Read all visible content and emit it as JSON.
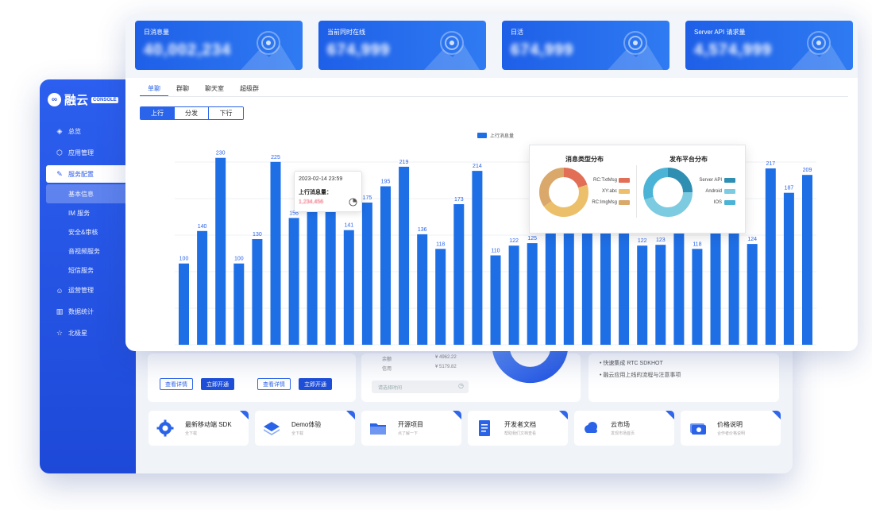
{
  "sidebar": {
    "brand": "融云",
    "brand_badge": "CONSOLE",
    "items": [
      {
        "label": "总览",
        "icon": "dashboard-icon"
      },
      {
        "label": "应用管理",
        "icon": "cube-icon"
      },
      {
        "label": "服务配置",
        "icon": "wrench-icon"
      },
      {
        "label": "基本信息"
      },
      {
        "label": "IM 服务"
      },
      {
        "label": "安全&审核"
      },
      {
        "label": "音视频服务"
      },
      {
        "label": "短信服务"
      },
      {
        "label": "运营管理",
        "icon": "user-group-icon"
      },
      {
        "label": "数据统计",
        "icon": "bar-chart-icon"
      },
      {
        "label": "北极星",
        "icon": "star-icon"
      }
    ]
  },
  "back": {
    "detail_label": "查看详情",
    "open_label": "立即开通",
    "money_1_label": "余额",
    "money_1": "¥ 4962.22",
    "money_2_label": "信用",
    "money_2": "¥ 5179.82",
    "search_placeholder": "请选择时间",
    "notices": [
      "快速集成 RTC SDKHOT",
      "融云应用上线的流程与注意事项"
    ],
    "tiles": [
      {
        "title": "最新移动端 SDK",
        "sub": "全下载",
        "icon": "gear-icon"
      },
      {
        "title": "Demo体验",
        "sub": "全下载",
        "icon": "layers-icon"
      },
      {
        "title": "开源项目",
        "sub": "点了解一下",
        "icon": "folder-icon"
      },
      {
        "title": "开发者文档",
        "sub": "帮助我们文档查看",
        "icon": "document-icon"
      },
      {
        "title": "云市场",
        "sub": "发现市场首页",
        "icon": "cloud-icon"
      },
      {
        "title": "价格说明",
        "sub": "合作者价格说明",
        "icon": "price-icon"
      }
    ]
  },
  "stats": [
    {
      "label": "日消息量",
      "value": "40,002,234"
    },
    {
      "label": "当前同时在线",
      "value": "674,999"
    },
    {
      "label": "日活",
      "value": "674,999"
    },
    {
      "label": "Server API 请求量",
      "value": "4,574,999"
    }
  ],
  "tabs": [
    "单聊",
    "群聊",
    "聊天室",
    "超级群"
  ],
  "segments": [
    "上行",
    "分发",
    "下行"
  ],
  "tooltip": {
    "date": "2023-02-14 23:59",
    "label": "上行消息量：",
    "value": "1,234,456"
  },
  "colors": {
    "primary": "#1e6fe6",
    "sidebar": "#2a5bea",
    "tooltip_value": "#e9435a"
  },
  "chart_data": {
    "type": "bar",
    "legend": "上行消息量",
    "legend_position": "top",
    "values": [
      100,
      140,
      230,
      100,
      130,
      225,
      156,
      190,
      178,
      141,
      175,
      195,
      219,
      136,
      118,
      173,
      214,
      110,
      122,
      125,
      160,
      145,
      160,
      143,
      140,
      122,
      123,
      160,
      118,
      160,
      160,
      124,
      217,
      187,
      209
    ],
    "labels": [
      "100",
      "140",
      "230",
      "100",
      "130",
      "225",
      "156",
      "",
      "178",
      "141",
      "175",
      "195",
      "219",
      "136",
      "118",
      "173",
      "214",
      "110",
      "122",
      "125",
      "",
      "145",
      "",
      "143",
      "140",
      "122",
      "123",
      "",
      "118",
      "",
      "",
      "124",
      "217",
      "187",
      "209"
    ],
    "ylim": [
      0,
      260
    ],
    "grid": true
  },
  "distribution": {
    "message_type": {
      "title": "消息类型分布",
      "items": [
        {
          "label": "RC:TxtMsg",
          "value": 20,
          "color": "#e16e55"
        },
        {
          "label": "XY:abc",
          "value": 45,
          "color": "#ecc06b"
        },
        {
          "label": "RC:ImgMsg",
          "value": 35,
          "color": "#d9a86a"
        }
      ]
    },
    "platform": {
      "title": "发布平台分布",
      "items": [
        {
          "label": "Server API",
          "value": 25,
          "color": "#2f8fb3"
        },
        {
          "label": "Android",
          "value": 45,
          "color": "#7ccbe0"
        },
        {
          "label": "IOS",
          "value": 30,
          "color": "#4bb4d6"
        }
      ]
    }
  }
}
